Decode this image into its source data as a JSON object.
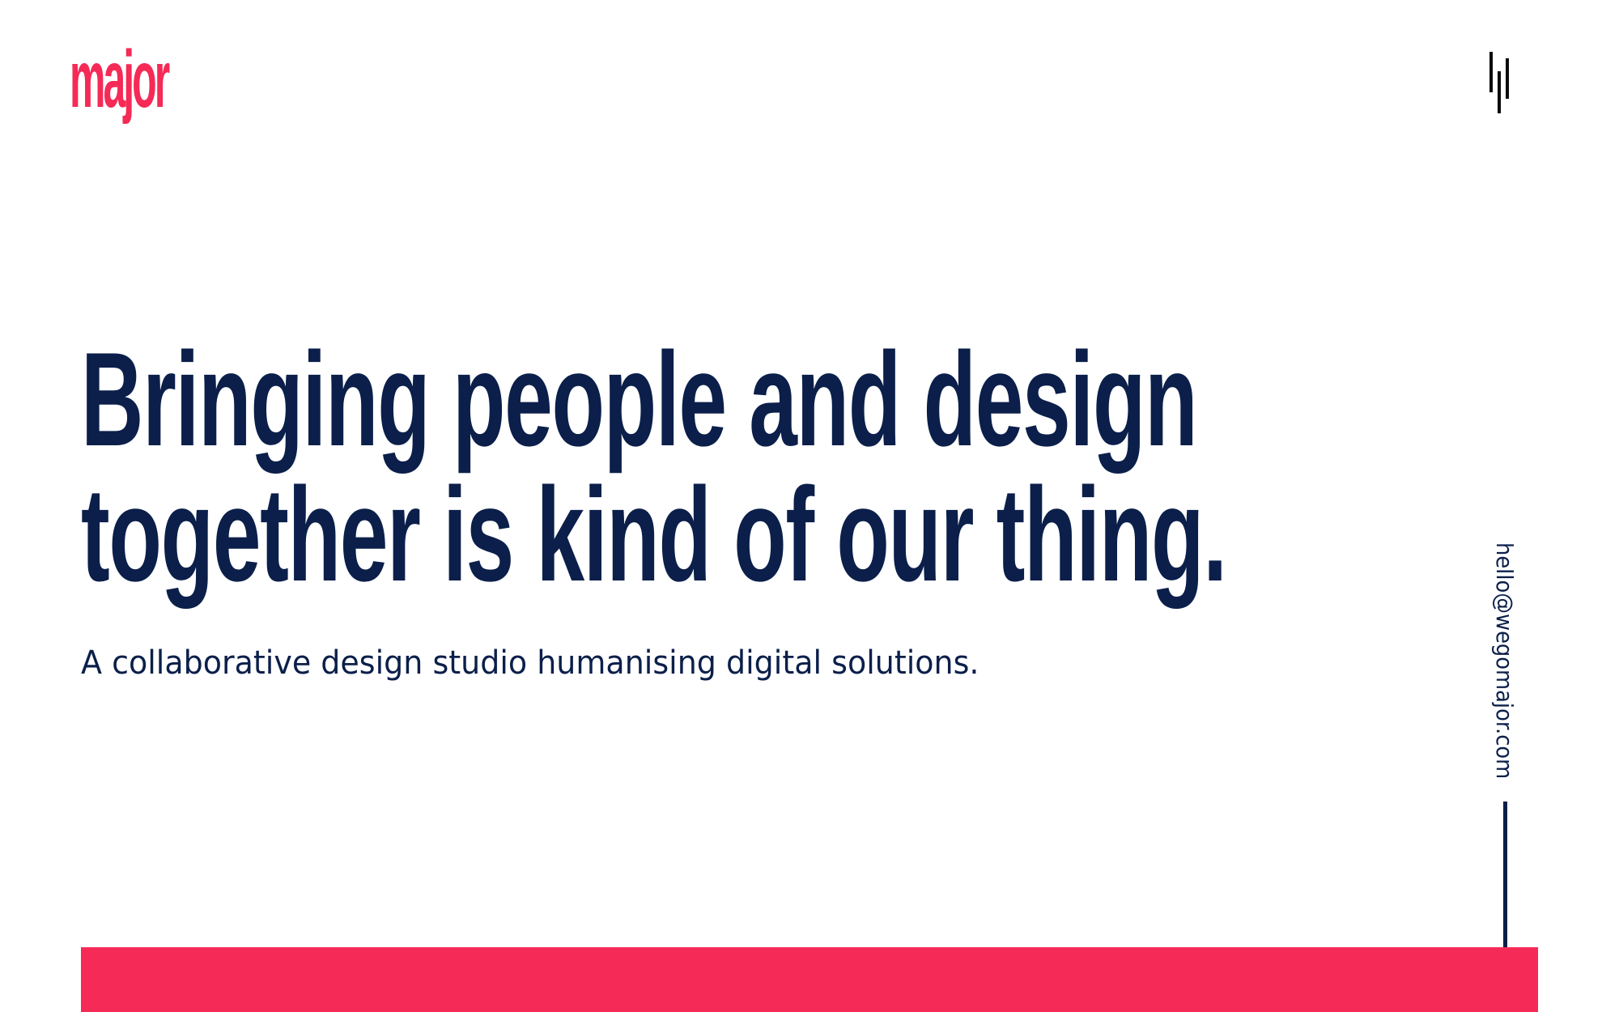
{
  "brand": {
    "logo_text": "major",
    "logo_color": "#f52a56"
  },
  "header": {
    "menu_icon": "menu-lines-icon"
  },
  "hero": {
    "headline_line1": "Bringing people and design",
    "headline_line2": "together is kind of our thing.",
    "subline": "A collaborative design studio humanising digital solutions."
  },
  "contact": {
    "email": "hello@wegomajor.com"
  },
  "colors": {
    "primary_text": "#0b1f4a",
    "accent": "#f52a56",
    "background": "#ffffff"
  }
}
